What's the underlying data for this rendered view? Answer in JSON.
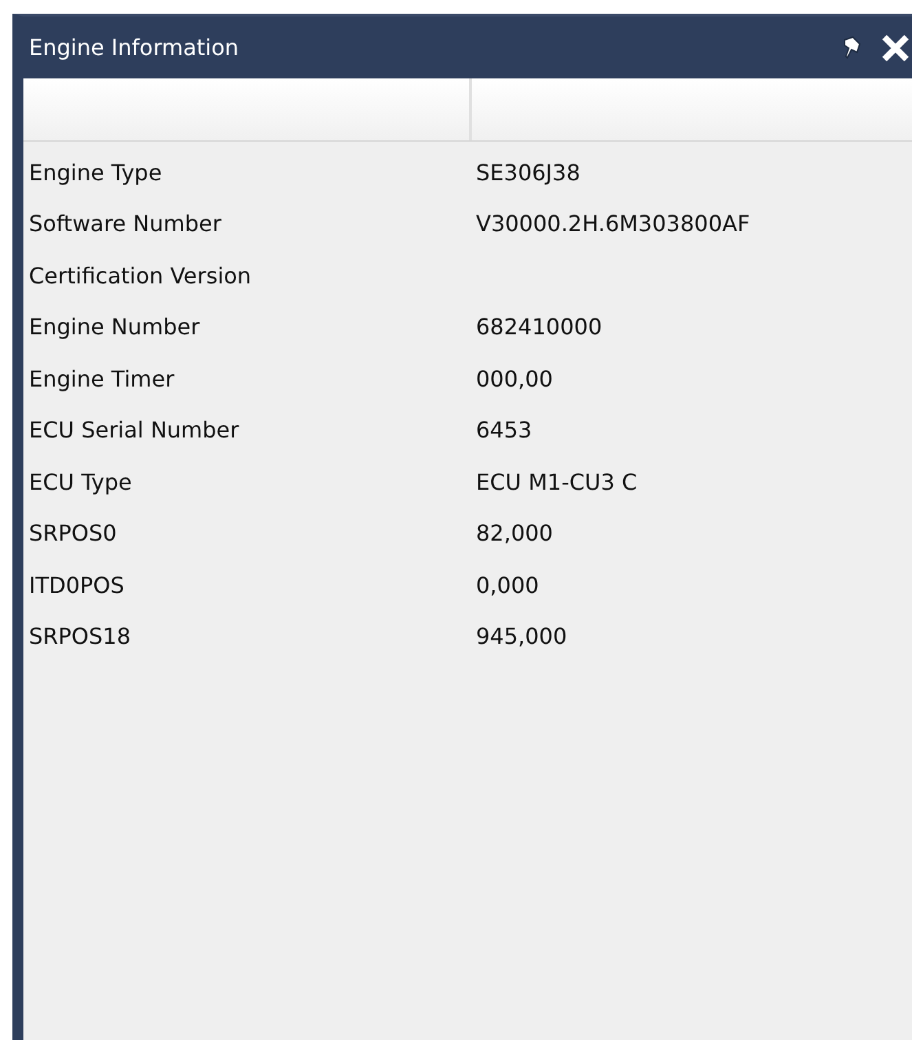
{
  "window": {
    "title": "Engine Information"
  },
  "rows": [
    {
      "label": "Engine Type",
      "value": "SE306J38"
    },
    {
      "label": "Software Number",
      "value": "V30000.2H.6M303800AF"
    },
    {
      "label": "Certification Version",
      "value": ""
    },
    {
      "label": "Engine Number",
      "value": "682410000"
    },
    {
      "label": "Engine Timer",
      "value": "000,00"
    },
    {
      "label": "ECU Serial Number",
      "value": "6453"
    },
    {
      "label": "ECU Type",
      "value": "ECU M1-CU3 C"
    },
    {
      "label": "SRPOS0",
      "value": "82,000"
    },
    {
      "label": "ITD0POS",
      "value": "0,000"
    },
    {
      "label": "SRPOS18",
      "value": "945,000"
    }
  ]
}
